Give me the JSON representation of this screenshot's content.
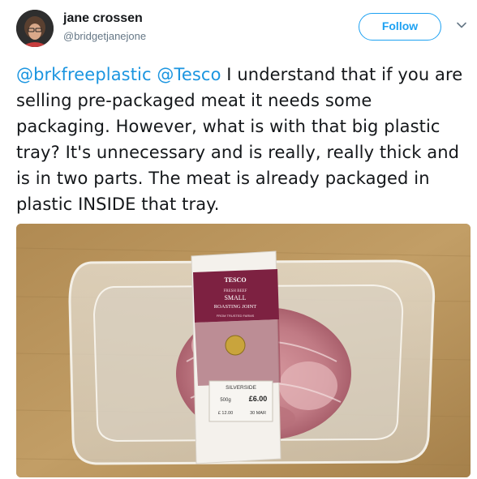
{
  "user": {
    "display_name": "jane crossen",
    "handle": "@bridgetjanejone"
  },
  "follow_label": "Follow",
  "tweet": {
    "mention1": "@brkfreeplastic",
    "mention2": "@Tesco",
    "body": " I understand that if you are selling pre-packaged meat it needs some packaging. However, what is with that big plastic tray? It's unnecessary and is really, really thick and is in two parts. The meat is already packaged in plastic INSIDE that tray."
  },
  "photo": {
    "brand": "TESCO",
    "line1": "FRESH BEEF",
    "line2": "SMALL",
    "line3": "ROASTING JOINT",
    "banner": "FROM TRUSTED FARMS",
    "cut": "SILVERSIDE",
    "weight": "500g",
    "price": "£6.00",
    "per_kg": "£ 12.00",
    "use_by": "30 MAR"
  },
  "colors": {
    "link": "#1b95e0",
    "follow": "#1da1f2",
    "label_maroon": "#7d2141"
  }
}
